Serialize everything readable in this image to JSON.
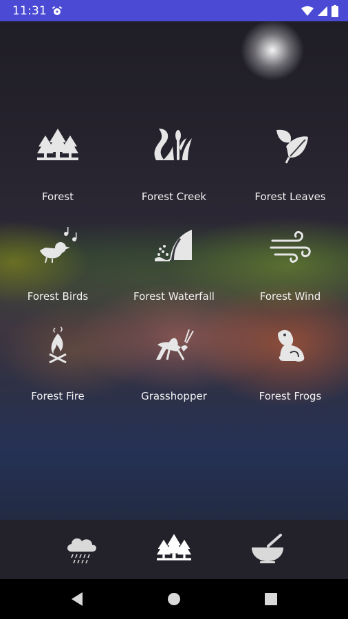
{
  "status_bar": {
    "time": "11:31"
  },
  "sounds": [
    {
      "label": "Forest",
      "icon": "forest-icon"
    },
    {
      "label": "Forest Creek",
      "icon": "creek-icon"
    },
    {
      "label": "Forest Leaves",
      "icon": "leaves-icon"
    },
    {
      "label": "Forest Birds",
      "icon": "birds-icon"
    },
    {
      "label": "Forest Waterfall",
      "icon": "waterfall-icon"
    },
    {
      "label": "Forest Wind",
      "icon": "wind-icon"
    },
    {
      "label": "Forest Fire",
      "icon": "fire-icon"
    },
    {
      "label": "Grasshopper",
      "icon": "grasshopper-icon"
    },
    {
      "label": "Forest Frogs",
      "icon": "frog-icon"
    }
  ],
  "bottom_nav": [
    {
      "icon": "rain-cloud-icon",
      "selected": false
    },
    {
      "icon": "forest-icon",
      "selected": true
    },
    {
      "icon": "bowl-icon",
      "selected": false
    }
  ],
  "colors": {
    "status_bar": "#4a4ad4",
    "icon": "#e6e6e6",
    "nav_bg": "#23212a"
  }
}
